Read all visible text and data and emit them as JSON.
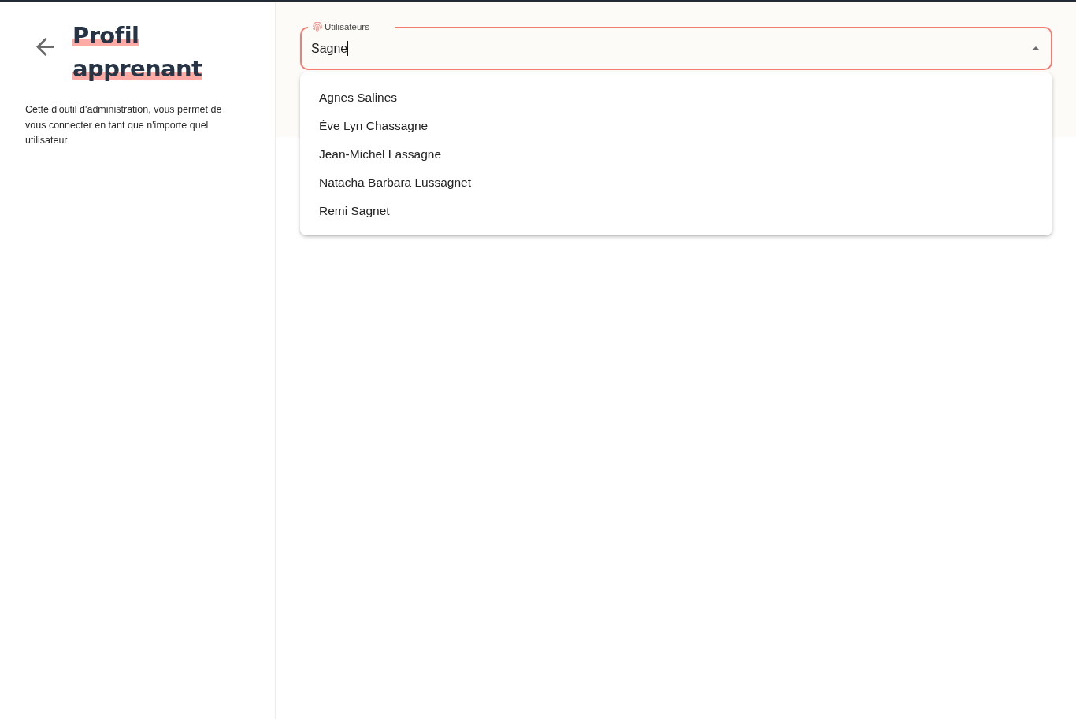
{
  "sidebar": {
    "title": "Profil apprenant",
    "description": "Cette d'outil d'administration, vous permet de vous connecter en tant que n'importe quel utilisateur"
  },
  "user_picker": {
    "label": "Utilisateurs",
    "value": "Sagne",
    "focused": true,
    "expanded": true,
    "options": [
      {
        "label": "Agnes Salines",
        "selected": false
      },
      {
        "label": "Ève Lyn Chassagne",
        "selected": false
      },
      {
        "label": "Jean-Michel Lassagne",
        "selected": false
      },
      {
        "label": "Natacha Barbara Lussagnet",
        "selected": false
      },
      {
        "label": "Remi Sagnet",
        "selected": false
      }
    ]
  }
}
